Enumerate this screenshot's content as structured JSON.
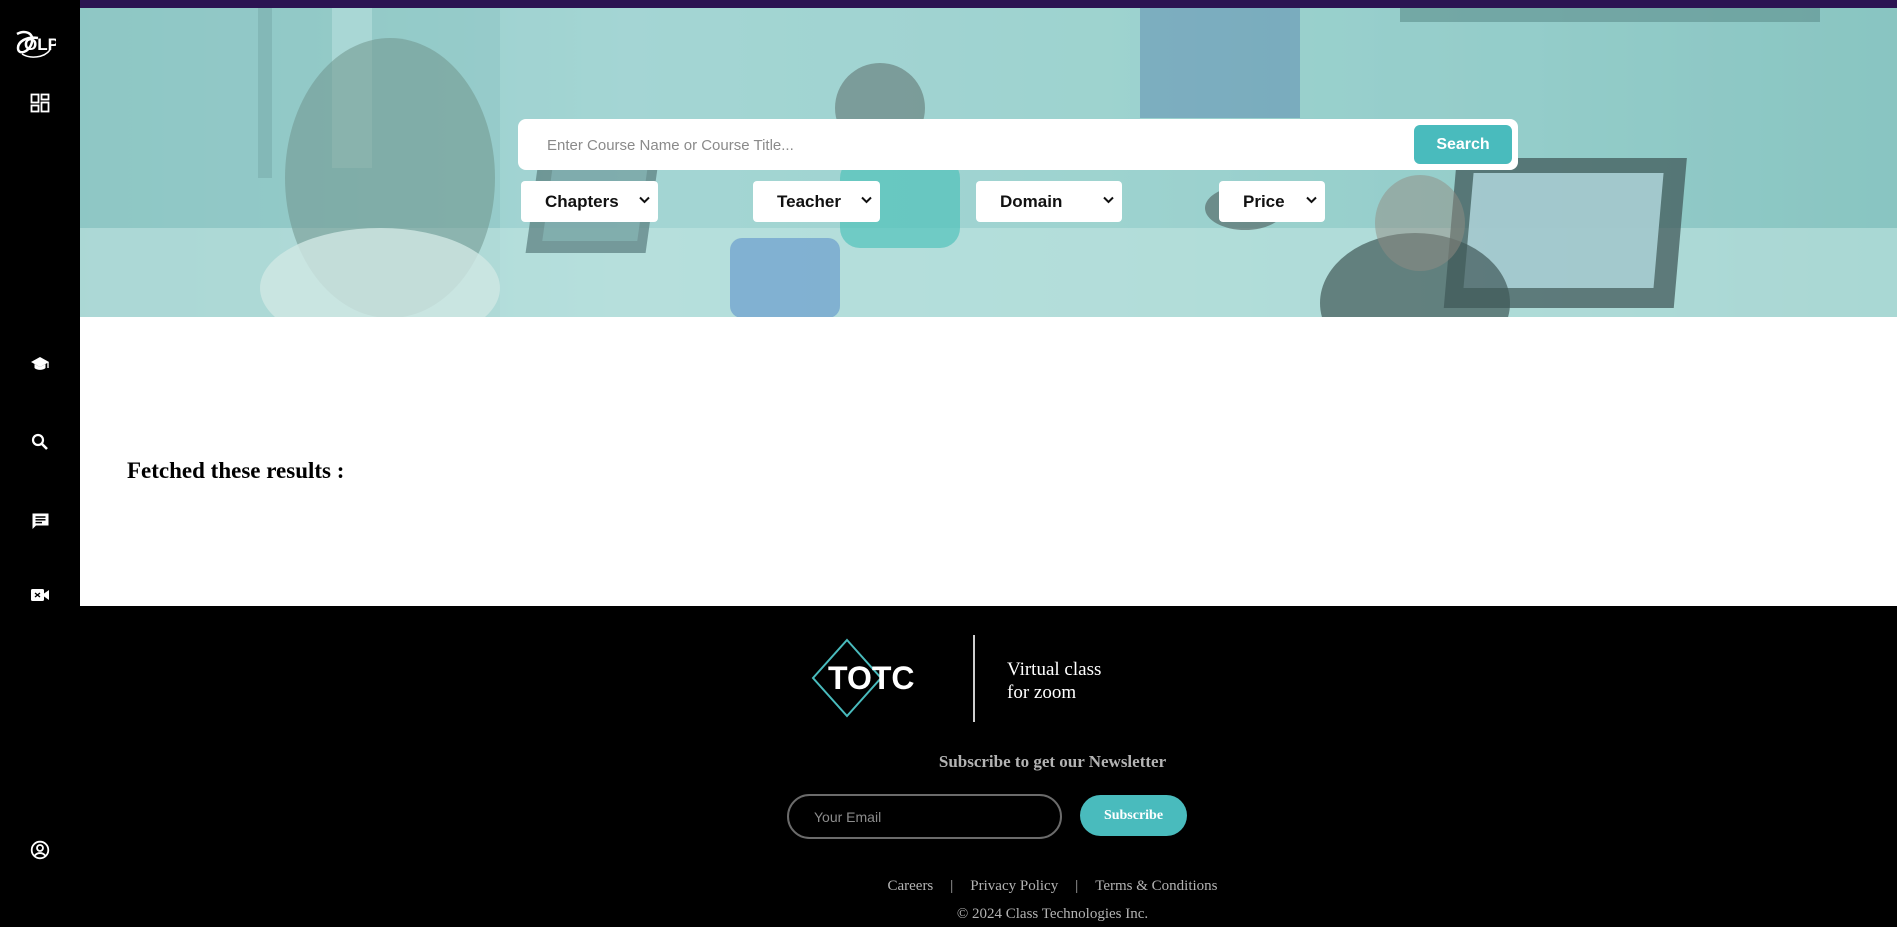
{
  "sidebar": {
    "logo_text": "OLP",
    "items": [
      {
        "icon": "dashboard-icon"
      },
      {
        "icon": "graduation-cap-icon"
      },
      {
        "icon": "search-icon"
      },
      {
        "icon": "chat-icon"
      },
      {
        "icon": "video-camera-icon"
      },
      {
        "icon": "user-account-icon"
      }
    ]
  },
  "search": {
    "placeholder": "Enter Course Name or Course Title...",
    "button_label": "Search"
  },
  "filters": {
    "chapters": "Chapters",
    "teacher": "Teacher",
    "domain": "Domain",
    "price": "Price"
  },
  "results": {
    "heading": "Fetched these results :"
  },
  "footer": {
    "logo_text": "TOTC",
    "tagline_line1": "Virtual class",
    "tagline_line2": "for zoom",
    "newsletter_title": "Subscribe to get our Newsletter",
    "email_placeholder": "Your Email",
    "subscribe_label": "Subscribe",
    "links": {
      "careers": "Careers",
      "privacy": "Privacy Policy",
      "terms": "Terms & Conditions",
      "separator": "|"
    },
    "copyright": "© 2024 Class Technologies Inc."
  },
  "colors": {
    "accent": "#49bbbd",
    "topbar": "#2b1452",
    "sidebar": "#000000",
    "footer": "#000000"
  }
}
